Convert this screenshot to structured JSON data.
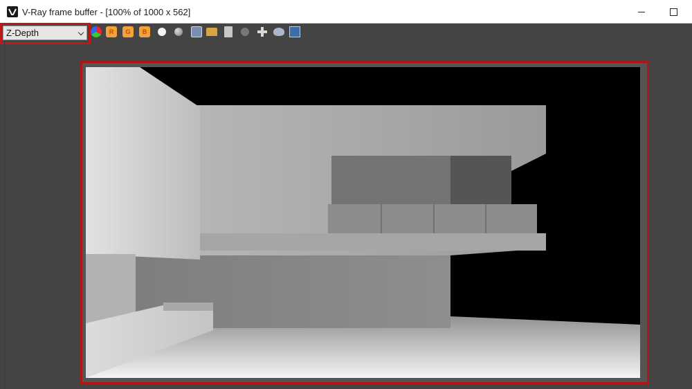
{
  "window": {
    "title": "V-Ray frame buffer - [100% of 1000 x 562]",
    "logo_icon": "vray-logo-icon",
    "minimize_icon": "minimize-icon",
    "maximize_icon": "maximize-icon"
  },
  "toolbar": {
    "channel_selected": "Z-Depth",
    "buttons": [
      {
        "name": "rgb-channels-icon",
        "label": ""
      },
      {
        "name": "red-channel-icon",
        "label": "R"
      },
      {
        "name": "green-channel-icon",
        "label": "G"
      },
      {
        "name": "blue-channel-icon",
        "label": "B"
      },
      {
        "name": "white-alpha-icon",
        "label": ""
      },
      {
        "name": "mono-icon",
        "label": ""
      },
      {
        "name": "save-icon",
        "label": ""
      },
      {
        "name": "load-icon",
        "label": ""
      },
      {
        "name": "duplicate-icon",
        "label": ""
      },
      {
        "name": "clear-icon",
        "label": ""
      },
      {
        "name": "track-mouse-icon",
        "label": ""
      },
      {
        "name": "teapot-render-icon",
        "label": ""
      },
      {
        "name": "vfb-history-icon",
        "label": ""
      }
    ]
  },
  "colors": {
    "highlight": "#c01818",
    "toolbar_accent": "#f2a23a",
    "panel_bg": "#444444"
  },
  "render": {
    "channel": "Z-Depth",
    "content": "z-depth-render-image"
  }
}
